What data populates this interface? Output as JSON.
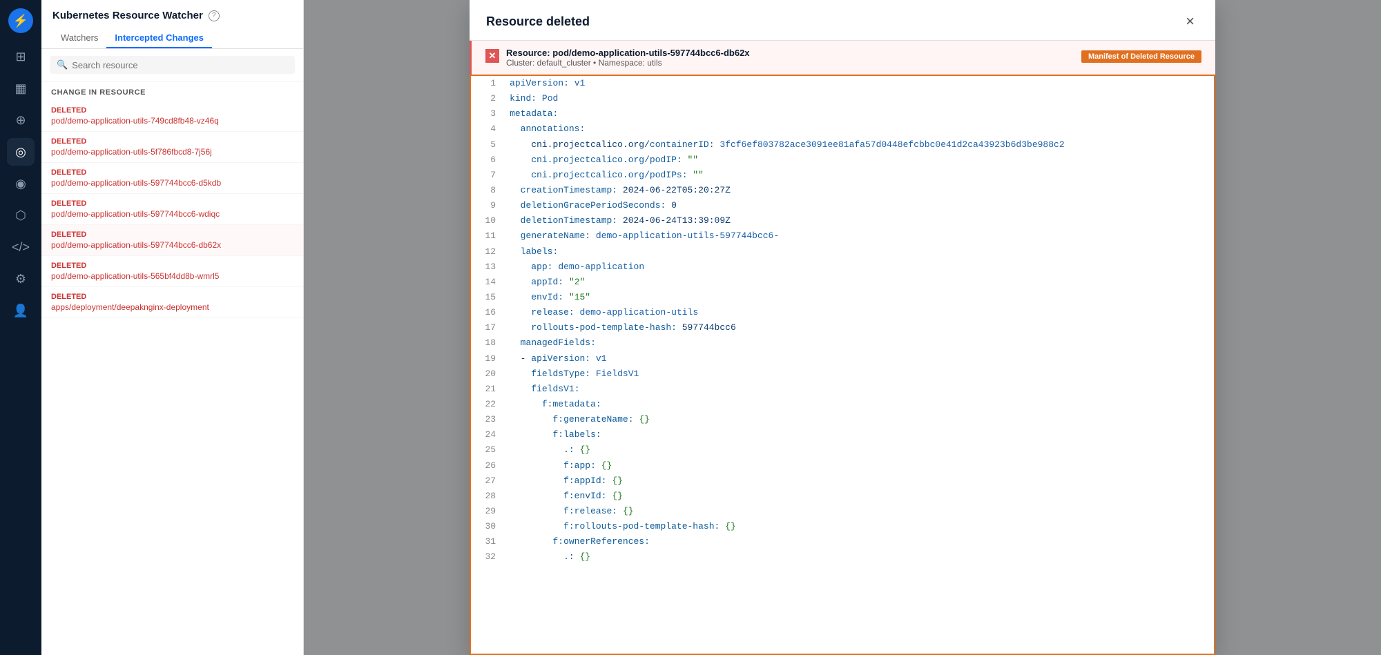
{
  "app": {
    "title": "Kubernetes Resource Watcher",
    "tabs": [
      "Watchers",
      "Intercepted Changes"
    ],
    "active_tab": "Intercepted Changes",
    "search_placeholder": "Search resource"
  },
  "sidebar": {
    "icons": [
      {
        "name": "logo",
        "glyph": "⚡"
      },
      {
        "name": "grid",
        "glyph": "⊞"
      },
      {
        "name": "chart",
        "glyph": "📊"
      },
      {
        "name": "plus-circle",
        "glyph": "⊕"
      },
      {
        "name": "globe",
        "glyph": "🌐"
      },
      {
        "name": "settings-circle",
        "glyph": "⚙"
      },
      {
        "name": "shield",
        "glyph": "🛡"
      },
      {
        "name": "code",
        "glyph": "</>"
      },
      {
        "name": "gear",
        "glyph": "⚙"
      },
      {
        "name": "user",
        "glyph": "👤"
      }
    ]
  },
  "section_label": "CHANGE IN RESOURCE",
  "resources": [
    {
      "status": "DELETED",
      "name": "pod/demo-application-utils-749cd8fb48-vz46q"
    },
    {
      "status": "DELETED",
      "name": "pod/demo-application-utils-5f786fbcd8-7j56j"
    },
    {
      "status": "DELETED",
      "name": "pod/demo-application-utils-597744bcc6-d5kdb"
    },
    {
      "status": "DELETED",
      "name": "pod/demo-application-utils-597744bcc6-wdiqc"
    },
    {
      "status": "DELETED",
      "name": "pod/demo-application-utils-597744bcc6-db62x",
      "selected": true
    },
    {
      "status": "DELETED",
      "name": "pod/demo-application-utils-565bf4dd8b-wmrl5"
    },
    {
      "status": "DELETED",
      "name": "apps/deployment/deepaknginx-deployment"
    }
  ],
  "modal": {
    "title": "Resource deleted",
    "close_label": "×",
    "banner": {
      "resource": "Resource: pod/demo-application-utils-597744bcc6-db62x",
      "cluster": "Cluster: default_cluster • Namespace: utils"
    },
    "manifest_tag": "Manifest of Deleted Resource",
    "code_lines": [
      {
        "num": 1,
        "content": "apiVersion: v1"
      },
      {
        "num": 2,
        "content": "kind: Pod"
      },
      {
        "num": 3,
        "content": "metadata:"
      },
      {
        "num": 4,
        "content": "  annotations:"
      },
      {
        "num": 5,
        "content": "    cni.projectcalico.org/containerID: 3fcf6ef803782ace3091ee81afa57d0448efcbbc0e41d2ca43923b6d3be988c2"
      },
      {
        "num": 6,
        "content": "    cni.projectcalico.org/podIP: \"\""
      },
      {
        "num": 7,
        "content": "    cni.projectcalico.org/podIPs: \"\""
      },
      {
        "num": 8,
        "content": "  creationTimestamp: 2024-06-22T05:20:27Z"
      },
      {
        "num": 9,
        "content": "  deletionGracePeriodSeconds: 0"
      },
      {
        "num": 10,
        "content": "  deletionTimestamp: 2024-06-24T13:39:09Z"
      },
      {
        "num": 11,
        "content": "  generateName: demo-application-utils-597744bcc6-"
      },
      {
        "num": 12,
        "content": "  labels:"
      },
      {
        "num": 13,
        "content": "    app: demo-application"
      },
      {
        "num": 14,
        "content": "    appId: \"2\""
      },
      {
        "num": 15,
        "content": "    envId: \"15\""
      },
      {
        "num": 16,
        "content": "    release: demo-application-utils"
      },
      {
        "num": 17,
        "content": "    rollouts-pod-template-hash: 597744bcc6"
      },
      {
        "num": 18,
        "content": "  managedFields:"
      },
      {
        "num": 19,
        "content": "  - apiVersion: v1"
      },
      {
        "num": 20,
        "content": "    fieldsType: FieldsV1"
      },
      {
        "num": 21,
        "content": "    fieldsV1:"
      },
      {
        "num": 22,
        "content": "      f:metadata:"
      },
      {
        "num": 23,
        "content": "        f:generateName: {}"
      },
      {
        "num": 24,
        "content": "        f:labels:"
      },
      {
        "num": 25,
        "content": "          .: {}"
      },
      {
        "num": 26,
        "content": "          f:app: {}"
      },
      {
        "num": 27,
        "content": "          f:appId: {}"
      },
      {
        "num": 28,
        "content": "          f:envId: {}"
      },
      {
        "num": 29,
        "content": "          f:release: {}"
      },
      {
        "num": 30,
        "content": "          f:rollouts-pod-template-hash: {}"
      },
      {
        "num": 31,
        "content": "        f:ownerReferences:"
      },
      {
        "num": 32,
        "content": "          .: {}"
      }
    ]
  }
}
